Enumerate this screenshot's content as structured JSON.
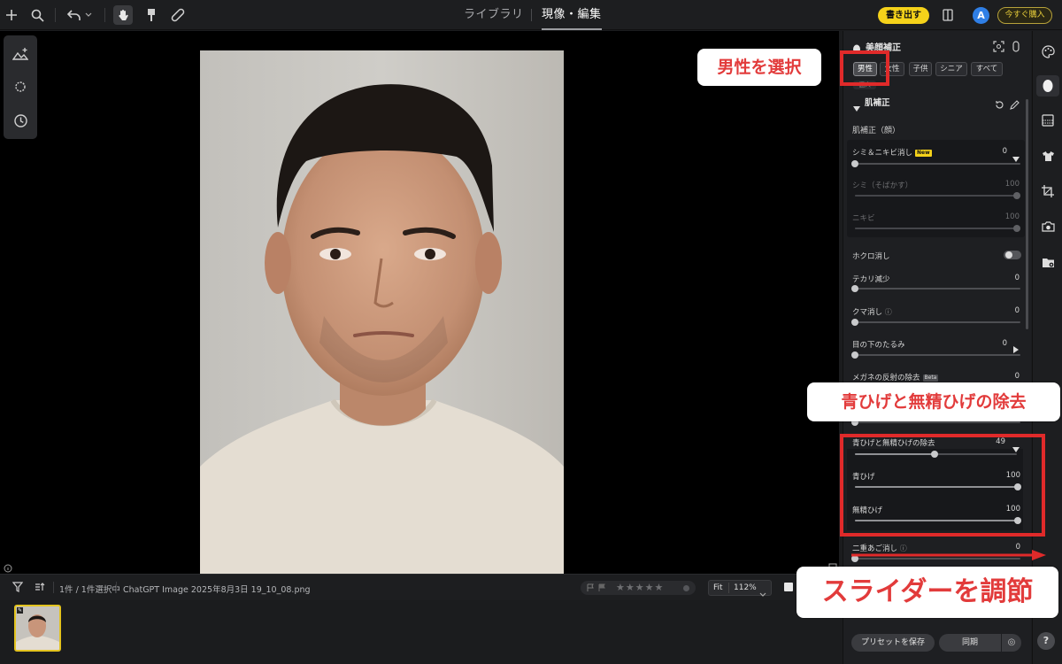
{
  "topbar": {
    "tab_library": "ライブラリ",
    "tab_develop": "現像・編集",
    "export_label": "書き出す",
    "avatar_letter": "A",
    "buy_label": "今すぐ購入"
  },
  "bottombar": {
    "selection_count": "1件 / 1件選択中",
    "filename": "ChatGPT Image 2025年8月3日 19_10_08.png",
    "fit_label": "Fit",
    "zoom": "112%"
  },
  "panel": {
    "title": "美顔補正",
    "gender_chips": [
      "男性",
      "女性",
      "子供",
      "シニア",
      "すべて"
    ],
    "chip_extra": "個人",
    "section_title": "肌補正",
    "subsection_face": "肌補正（顔）",
    "rows": {
      "spot_acne": {
        "label": "シミ＆ニキビ消し",
        "badge": "New",
        "value": "0",
        "level": 0
      },
      "spots": {
        "label": "シミ（そばかす）",
        "value": "100",
        "level": 1.0
      },
      "acne": {
        "label": "ニキビ",
        "value": "100",
        "level": 1.0
      },
      "mole": {
        "label": "ホクロ消し",
        "toggle": false
      },
      "shine": {
        "label": "テカリ減少",
        "value": "0",
        "level": 0
      },
      "dark_circles": {
        "label": "クマ消し",
        "value": "0",
        "level": 0
      },
      "eye_bags": {
        "label": "目の下のたるみ",
        "value": "0",
        "level": 0
      },
      "glasses": {
        "label": "メガネの反射の除去",
        "badge": "Beta",
        "value": "0"
      },
      "beard_removal": {
        "label": "青ひげと無精ひげの除去",
        "value": "49",
        "level": 0.49
      },
      "blue_beard": {
        "label": "青ひげ",
        "value": "100",
        "level": 1.0
      },
      "stubble": {
        "label": "無精ひげ",
        "value": "100",
        "level": 1.0
      },
      "double_chin": {
        "label": "二重あご消し",
        "value": "0",
        "level": 0
      }
    },
    "save_preset": "プリセットを保存",
    "sync": "同期"
  },
  "help_label": "?",
  "annotations": {
    "select_male": "男性を選択",
    "beard_removal": "青ひげと無精ひげの除去",
    "adjust_slider": "スライダーを調節"
  },
  "colors": {
    "accent_yellow": "#f5d21a",
    "annotation_red": "#e02a2a",
    "avatar_blue": "#2f7fe6"
  }
}
